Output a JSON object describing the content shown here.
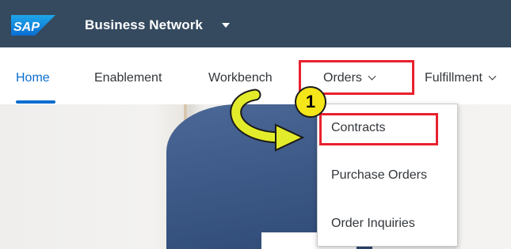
{
  "shell": {
    "logo_text": "SAP",
    "app_title": "Business Network"
  },
  "tabs": [
    {
      "label": "Home",
      "active": true
    },
    {
      "label": "Enablement"
    },
    {
      "label": "Workbench"
    },
    {
      "label": "Orders"
    },
    {
      "label": "Fulfillment"
    }
  ],
  "menu": {
    "items": [
      {
        "label": "Contracts"
      },
      {
        "label": "Purchase Orders"
      },
      {
        "label": "Order Inquiries"
      }
    ]
  },
  "annotation": {
    "step_number": "1",
    "highlight_color": "#e8212e",
    "badge_color": "#f5e619",
    "arrow_color": "#e3ec2a"
  },
  "colors": {
    "shellbar": "#354a5f",
    "accent": "#0a6ed1"
  }
}
